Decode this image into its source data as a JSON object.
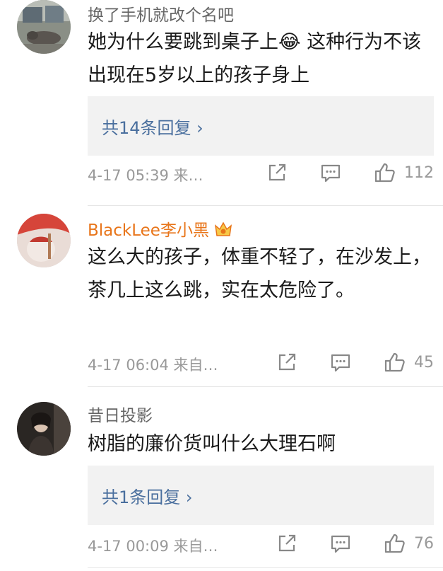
{
  "comments": [
    {
      "username": "换了手机就改个名吧",
      "text": "她为什么要跳到桌子上😂 这种行为不该出现在5岁以上的孩子身上",
      "replies_label": "共14条回复 ›",
      "time": "4-17 05:39 来…",
      "likes": "112"
    },
    {
      "username": "BlackLee李小黑",
      "text": "这么大的孩子，体重不轻了，在沙发上，茶几上这么跳，实在太危险了。",
      "time": "4-17 06:04 来自…",
      "likes": "45"
    },
    {
      "username": "昔日投影",
      "text": "树脂的廉价货叫什么大理石啊",
      "replies_label": "共1条回复 ›",
      "time": "4-17 00:09 来自…",
      "likes": "76"
    }
  ],
  "icons": {
    "share": "share-icon",
    "comment": "comment-icon",
    "like": "thumbs-up-icon",
    "vip": "vip-crown-badge-icon"
  },
  "colors": {
    "username": "#666666",
    "vip_username": "#e8751a",
    "reply_link": "#4a6f9e",
    "meta": "#999999",
    "reply_box": "#f2f2f2"
  }
}
